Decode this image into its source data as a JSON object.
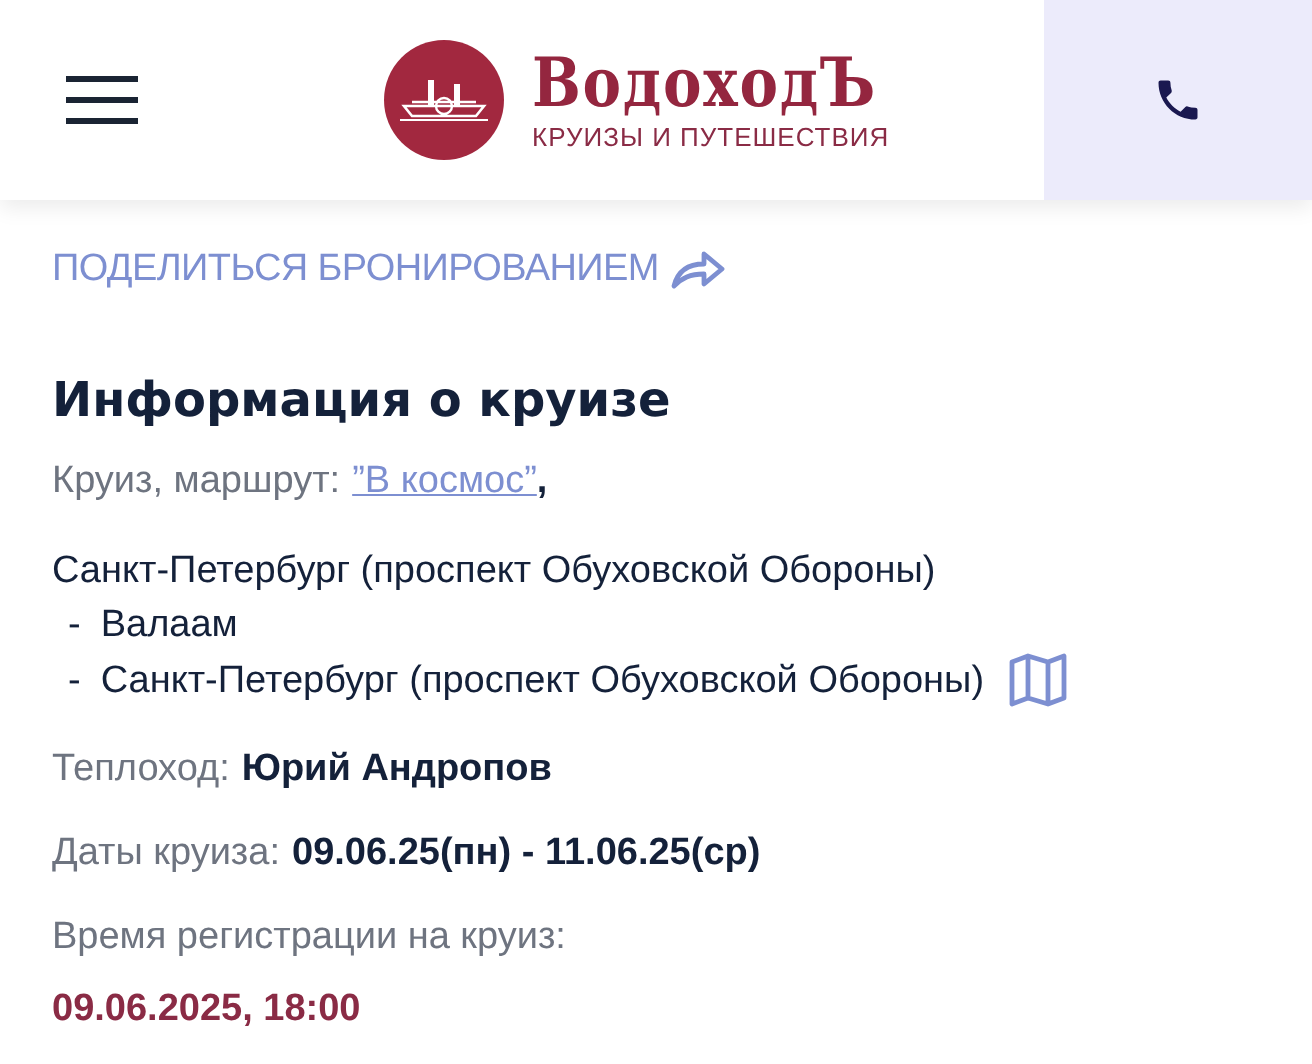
{
  "header": {
    "brand": "ВодоходЪ",
    "tagline": "КРУИЗЫ И ПУТЕШЕСТВИЯ"
  },
  "share_link": "ПОДЕЛИТЬСЯ БРОНИРОВАНИЕМ",
  "section_title": "Информация о круизе",
  "route": {
    "label": "Круиз, маршрут:",
    "name": "”В космос”",
    "separator": ",",
    "stops": [
      {
        "name": "Санкт-Петербург (проспект Обуховской Обороны)"
      },
      {
        "prefix": "-",
        "name": "Валаам"
      },
      {
        "prefix": "-",
        "name": "Санкт-Петербург (проспект Обуховской Обороны)"
      }
    ]
  },
  "details": [
    {
      "label": "Теплоход:",
      "value": "Юрий Андропов",
      "kind": "inline"
    },
    {
      "label": "Даты круиза:",
      "value": "09.06.25(пн) - 11.06.25(ср)",
      "kind": "inline"
    },
    {
      "label": "Время регистрации на круиз:",
      "value": "09.06.2025, 18:00",
      "kind": "stacked"
    }
  ]
}
